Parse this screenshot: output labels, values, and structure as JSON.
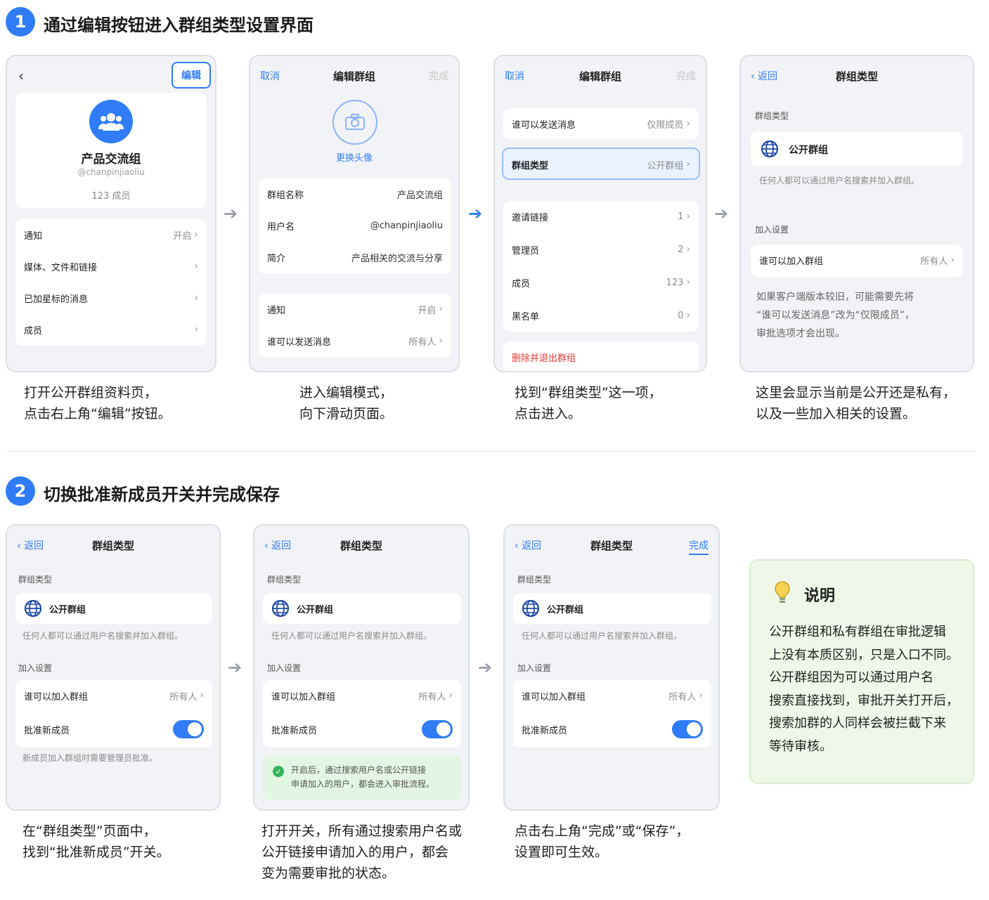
{
  "step1": {
    "num": "1",
    "title": "通过编辑按钮进入群组类型设置界面",
    "phone1": {
      "edit_btn": "编辑",
      "group_name": "产品交流组",
      "handle": "@chanpinjiaoliu",
      "members": "123 成员",
      "rows": [
        {
          "label": "通知",
          "value": "开启"
        },
        {
          "label": "媒体、文件和链接",
          "value": ""
        },
        {
          "label": "已加星标的消息",
          "value": ""
        },
        {
          "label": "成员",
          "value": ""
        }
      ]
    },
    "phone2": {
      "cancel": "取消",
      "title": "编辑群组",
      "done": "完成",
      "change_avatar": "更换头像",
      "rows": [
        {
          "label": "群组名称",
          "value": "产品交流组"
        },
        {
          "label": "用户名",
          "value": "@chanpinjiaoliu"
        },
        {
          "label": "简介",
          "value": "产品相关的交流与分享"
        }
      ],
      "rows2": [
        {
          "label": "通知",
          "value": "开启"
        },
        {
          "label": "谁可以发送消息",
          "value": "所有人"
        }
      ]
    },
    "phone3": {
      "cancel": "取消",
      "title": "编辑群组",
      "done": "完成",
      "row_send": {
        "label": "谁可以发送消息",
        "value": "仅限成员"
      },
      "row_type": {
        "label": "群组类型",
        "value": "公开群组"
      },
      "rows": [
        {
          "label": "邀请链接",
          "value": "1"
        },
        {
          "label": "管理员",
          "value": "2"
        },
        {
          "label": "成员",
          "value": "123"
        },
        {
          "label": "黑名单",
          "value": "0"
        }
      ],
      "delete": "删除并退出群组"
    },
    "phone4": {
      "back": "返回",
      "title": "群组类型",
      "sec_type": "群组类型",
      "public": "公开群组",
      "public_hint": "任何人都可以通过用户名搜索并加入群组。",
      "sec_join": "加入设置",
      "row_join": {
        "label": "谁可以加入群组",
        "value": "所有人"
      },
      "note": [
        "如果客户端版本较旧，可能需要先将",
        "“谁可以发送消息”改为“仅限成员”，",
        "审批选项才会出现。"
      ]
    },
    "captions": [
      [
        "打开公开群组资料页，",
        "点击右上角“编辑”按钮。"
      ],
      [
        "进入编辑模式，",
        "向下滑动页面。"
      ],
      [
        "找到“群组类型”这一项，",
        "点击进入。"
      ],
      [
        "这里会显示当前是公开还是私有，",
        "以及一些加入相关的设置。"
      ]
    ]
  },
  "step2": {
    "num": "2",
    "title": "切换批准新成员开关并完成保存",
    "common": {
      "back": "返回",
      "title": "群组类型",
      "sec_type": "群组类型",
      "public": "公开群组",
      "public_hint": "任何人都可以通过用户名搜索并加入群组。",
      "sec_join": "加入设置",
      "row_join_label": "谁可以加入群组",
      "row_join_value": "所有人",
      "approve": "批准新成员"
    },
    "phone1_hint": "新成员加入群组时需要管理员批准。",
    "phone2_tip": [
      "开启后，通过搜索用户名或公开链接",
      "申请加入的用户，都会进入审批流程。"
    ],
    "phone3_done": "完成",
    "captions": [
      [
        "在“群组类型”页面中，",
        "找到“批准新成员”开关。"
      ],
      [
        "打开开关，所有通过搜索用户名或",
        "公开链接申请加入的用户，都会",
        "变为需要审批的状态。"
      ],
      [
        "点击右上角“完成”或“保存”，",
        "设置即可生效。"
      ]
    ]
  },
  "note_box": {
    "title": "说明",
    "lines": [
      "公开群组和私有群组在审批逻辑",
      "上没有本质区别，只是入口不同。",
      "公开群组因为可以通过用户名",
      "搜索直接找到，审批开关打开后，",
      "搜索加群的人同样会被拦截下来",
      "等待审核。"
    ]
  },
  "colors": {
    "accent": "#2f7cf6",
    "danger": "#e53935",
    "tip_bg": "#e3f5e3",
    "note_bg": "#eef7e8"
  }
}
